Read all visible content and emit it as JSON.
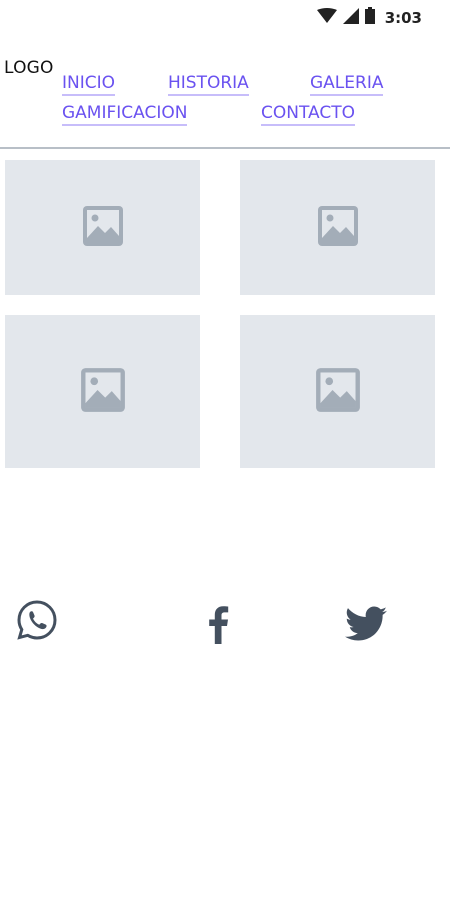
{
  "status_bar": {
    "time": "3:03",
    "icons": [
      "wifi-icon",
      "signal-icon",
      "battery-icon"
    ]
  },
  "header": {
    "logo": "LOGO",
    "nav": [
      {
        "label": "INICIO"
      },
      {
        "label": "HISTORIA"
      },
      {
        "label": "GALERIA"
      },
      {
        "label": "GAMIFICACION"
      },
      {
        "label": "CONTACTO"
      }
    ]
  },
  "gallery": {
    "items": [
      {
        "icon": "image-placeholder-icon"
      },
      {
        "icon": "image-placeholder-icon"
      },
      {
        "icon": "image-placeholder-icon"
      },
      {
        "icon": "image-placeholder-icon"
      }
    ]
  },
  "social": {
    "items": [
      {
        "icon": "whatsapp-icon"
      },
      {
        "icon": "facebook-icon"
      },
      {
        "icon": "twitter-icon"
      }
    ]
  },
  "colors": {
    "link": "#6a52f0",
    "link_underline": "#c7bdfa",
    "placeholder_bg": "#e3e7ec",
    "placeholder_icon": "#a3adb8",
    "social_icon": "#44505f",
    "divider": "#b8bfc7"
  }
}
